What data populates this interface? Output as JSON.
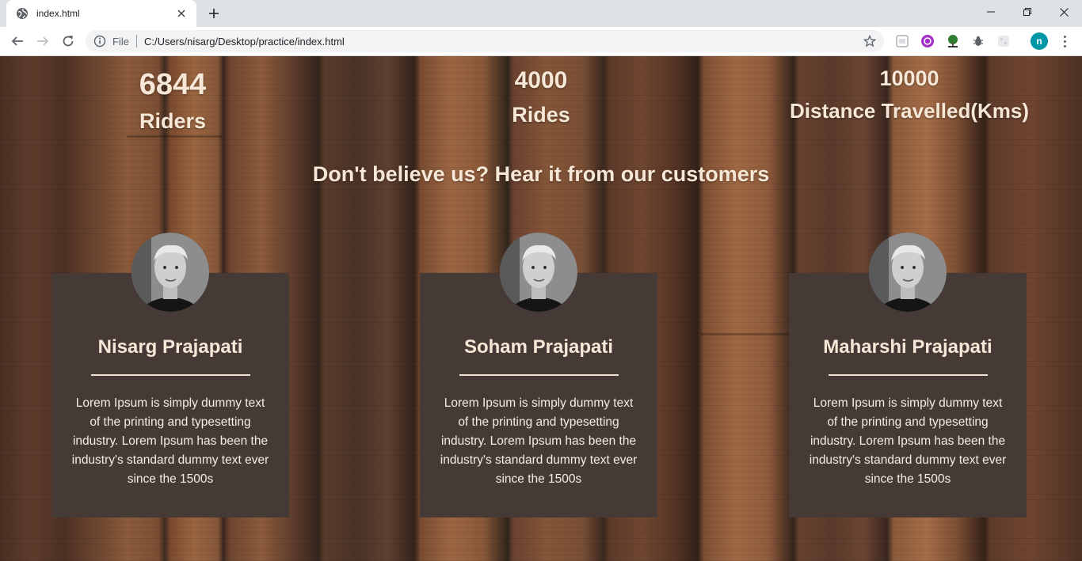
{
  "browser": {
    "tab_title": "index.html",
    "new_tab_label": "+",
    "omnibox_scheme": "File",
    "url": "C:/Users/nisarg/Desktop/practice/index.html",
    "profile_initial": "n"
  },
  "stats": [
    {
      "value": "6844",
      "label": "Riders"
    },
    {
      "value": "4000",
      "label": "Rides"
    },
    {
      "value": "10000",
      "label": "Distance Travelled(Kms)"
    }
  ],
  "headline": "Don't believe us? Hear it from our customers",
  "testimonials": [
    {
      "name": "Nisarg Prajapati",
      "text": "Lorem Ipsum is simply dummy text of the printing and typesetting industry. Lorem Ipsum has been the industry's standard dummy text ever since the 1500s"
    },
    {
      "name": "Soham Prajapati",
      "text": "Lorem Ipsum is simply dummy text of the printing and typesetting industry. Lorem Ipsum has been the industry's standard dummy text ever since the 1500s"
    },
    {
      "name": "Maharshi Prajapati",
      "text": "Lorem Ipsum is simply dummy text of the printing and typesetting industry. Lorem Ipsum has been the industry's standard dummy text ever since the 1500s"
    }
  ],
  "colors": {
    "card_background": "#463a37",
    "heading_text": "#f6e7d6",
    "profile_avatar": "#0097a7"
  }
}
